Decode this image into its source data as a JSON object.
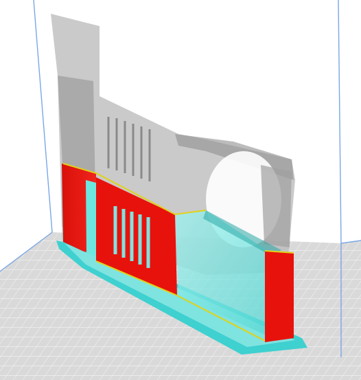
{
  "viewport": {
    "background": "#ffffff",
    "build_volume_line_color": "#7aa6e6",
    "bed_color": "#d9d9d9",
    "bed_grid_color": "#ffffff",
    "ghost_model_color": "#a9a9a9",
    "wall_color": "#e8120c",
    "infill_color": "#6ee6e0",
    "skin_color": "#e0d21a",
    "support_color": "#3fd0d0"
  }
}
